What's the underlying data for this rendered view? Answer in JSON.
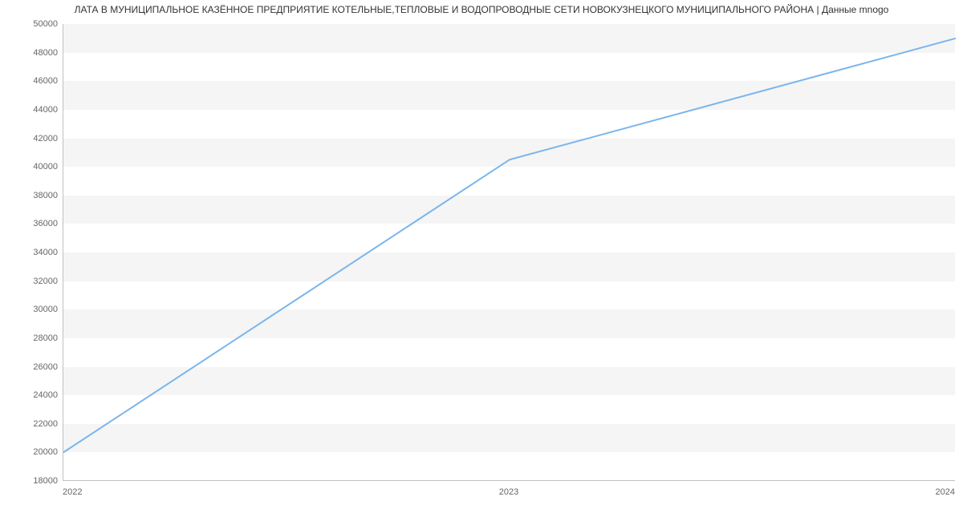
{
  "chart_data": {
    "type": "line",
    "title": "ЛАТА В МУНИЦИПАЛЬНОЕ КАЗЁННОЕ ПРЕДПРИЯТИЕ  КОТЕЛЬНЫЕ,ТЕПЛОВЫЕ И ВОДОПРОВОДНЫЕ СЕТИ НОВОКУЗНЕЦКОГО МУНИЦИПАЛЬНОГО РАЙОНА | Данные mnogo",
    "x": [
      2022,
      2023,
      2024
    ],
    "values": [
      20000,
      40500,
      49000
    ],
    "xlabel": "",
    "ylabel": "",
    "xlim": [
      2022,
      2024
    ],
    "ylim": [
      18000,
      50000
    ],
    "y_ticks": [
      18000,
      20000,
      22000,
      24000,
      26000,
      28000,
      30000,
      32000,
      34000,
      36000,
      38000,
      40000,
      42000,
      44000,
      46000,
      48000,
      50000
    ],
    "x_ticks": [
      2022,
      2023,
      2024
    ],
    "line_color": "#7cb5ec"
  }
}
